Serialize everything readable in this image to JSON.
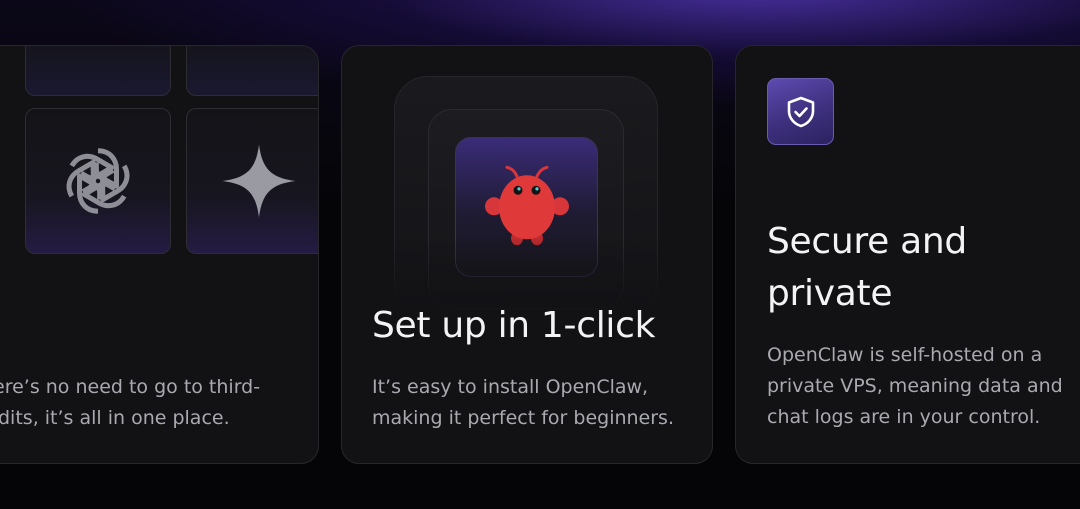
{
  "colors": {
    "accent": "#4b3a9c",
    "card_bg": "#121215",
    "text_primary": "#f3f3f5",
    "text_secondary": "#a9a9b0",
    "mascot": "#e0393a"
  },
  "cards": {
    "left": {
      "icons": [
        "openai-icon",
        "sparkle-icon"
      ],
      "description_lines": [
        "ere’s no need to go to third-",
        "dits, it’s all in one place."
      ]
    },
    "middle": {
      "icon": "mascot-icon",
      "title": "Set up in 1-click",
      "description": "It’s easy to install OpenClaw, making it perfect for beginners."
    },
    "right": {
      "icon": "shield-check-icon",
      "title_lines": [
        "Secure and",
        "private"
      ],
      "description": "OpenClaw is self-hosted on a private VPS, meaning data and chat logs are in your control."
    }
  }
}
